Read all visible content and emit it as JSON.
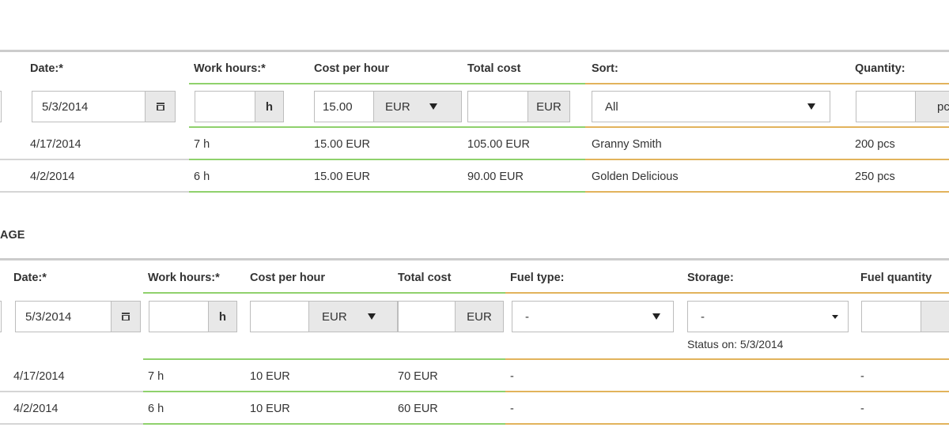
{
  "harvest_table": {
    "headers": {
      "date": "Date:*",
      "work_hours": "Work hours:*",
      "cost_per_hour": "Cost per hour",
      "total_cost": "Total cost",
      "sort": "Sort:",
      "quantity": "Quantity:"
    },
    "form": {
      "date_value": "5/3/2014",
      "work_hours_value": "",
      "work_hours_unit": "h",
      "cost_value": "15.00",
      "cost_currency": "EUR",
      "total_value": "",
      "total_currency": "EUR",
      "sort_value": "All",
      "quantity_value": "",
      "quantity_unit": "pcs"
    },
    "rows": [
      {
        "date": "4/17/2014",
        "hours": "7 h",
        "cost": "15.00 EUR",
        "total": "105.00 EUR",
        "sort": "Granny Smith",
        "quantity": "200 pcs"
      },
      {
        "date": "4/2/2014",
        "hours": "6 h",
        "cost": "15.00 EUR",
        "total": "90.00 EUR",
        "sort": "Golden Delicious",
        "quantity": "250 pcs"
      }
    ]
  },
  "fuel_section": {
    "title": "AGE",
    "headers": {
      "date": "Date:*",
      "work_hours": "Work hours:*",
      "cost_per_hour": "Cost per hour",
      "total_cost": "Total cost",
      "fuel_type": "Fuel type:",
      "storage": "Storage:",
      "fuel_quantity": "Fuel quantity"
    },
    "form": {
      "date_value": "5/3/2014",
      "work_hours_value": "",
      "work_hours_unit": "h",
      "cost_value": "",
      "cost_currency": "EUR",
      "total_value": "",
      "total_currency": "EUR",
      "fuel_type_value": "-",
      "storage_value": "-",
      "storage_status": "Status on: 5/3/2014",
      "fuel_quantity_value": ""
    },
    "rows": [
      {
        "date": "4/17/2014",
        "hours": "7 h",
        "cost": "10 EUR",
        "total": "70 EUR",
        "fuel_type": "-",
        "fuel_quantity": "-"
      },
      {
        "date": "4/2/2014",
        "hours": "6 h",
        "cost": "10 EUR",
        "total": "60 EUR",
        "fuel_type": "-",
        "fuel_quantity": "-"
      }
    ]
  },
  "colors": {
    "top_bar": "#cccccc",
    "green_rule": "#8fd16c",
    "orange_rule": "#e2b35c",
    "addon_bg": "#e8e8e8"
  }
}
